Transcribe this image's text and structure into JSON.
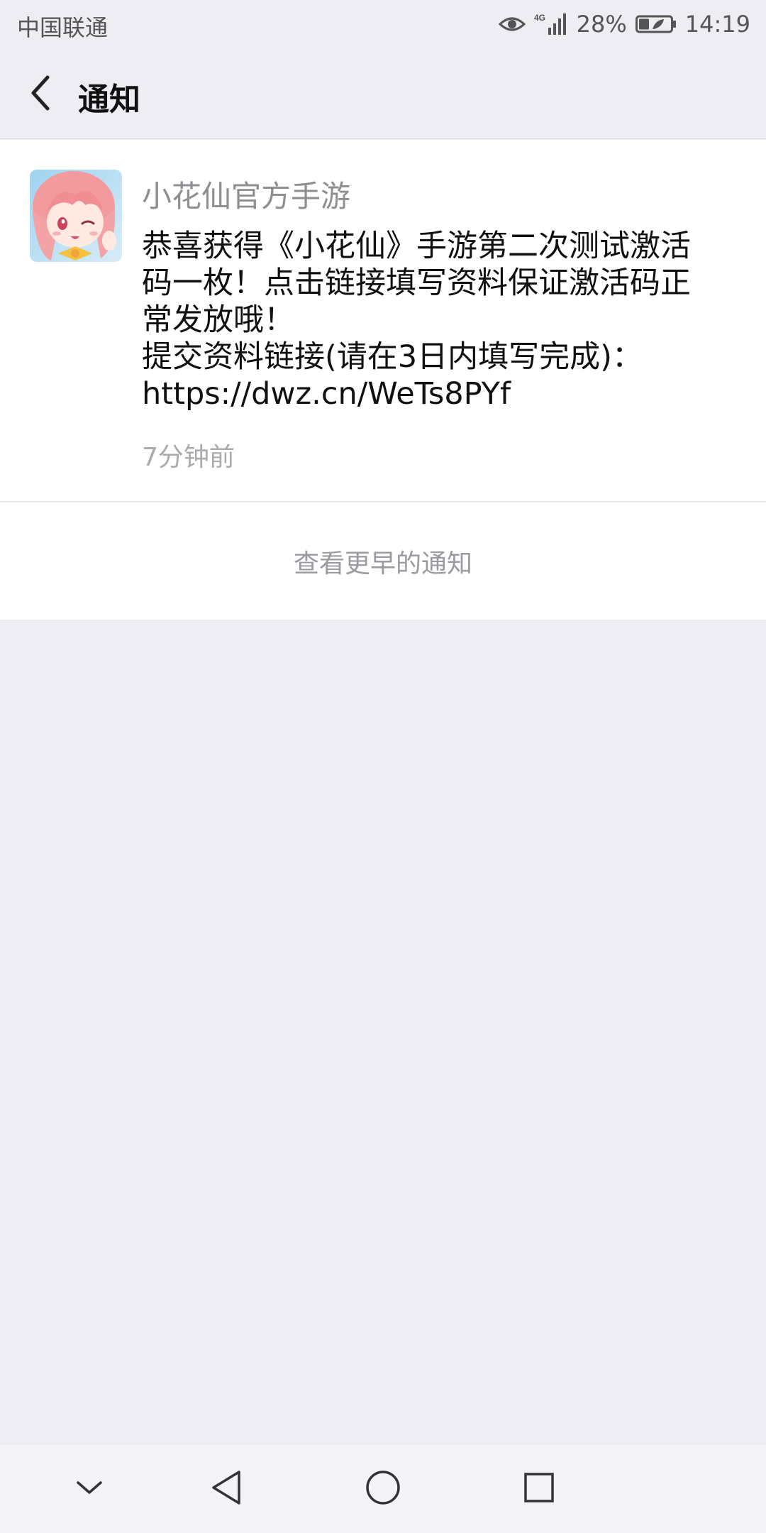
{
  "status_bar": {
    "carrier": "中国联通",
    "network": "4G",
    "battery": "28%",
    "time": "14:19"
  },
  "header": {
    "title": "通知"
  },
  "notification": {
    "sender": "小花仙官方手游",
    "message_lines": [
      "恭喜获得《小花仙》手游第二次测试激活",
      "码一枚！点击链接填写资料保证激活码正",
      "常发放哦！",
      "提交资料链接(请在3日内填写完成)：",
      "https://dwz.cn/WeTs8PYf"
    ],
    "time": "7分钟前"
  },
  "view_earlier": "查看更早的通知",
  "icons": {
    "back": "chevron-left-icon",
    "eye": "eye-icon",
    "signal": "signal-icon",
    "battery": "battery-icon",
    "nav_down": "chevron-down-icon",
    "nav_back": "triangle-back-icon",
    "nav_home": "circle-home-icon",
    "nav_recent": "square-recent-icon"
  }
}
